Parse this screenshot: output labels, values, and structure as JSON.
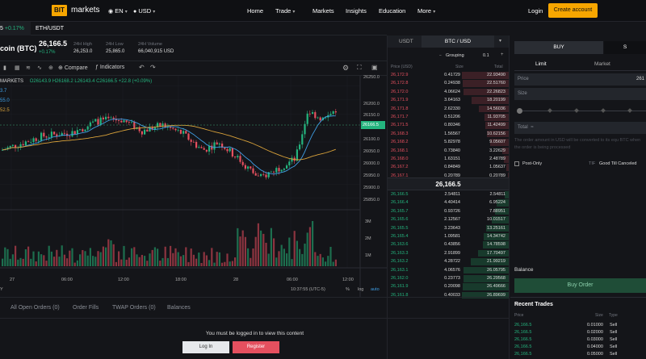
{
  "nav": {
    "logo_box": "BIT",
    "logo_text": "markets",
    "lang": "EN",
    "currency": "USD",
    "links": [
      "Home",
      "Trade",
      "Markets",
      "Insights",
      "Education",
      "More"
    ],
    "login": "Login",
    "create": "Create account"
  },
  "tabs": {
    "t1_price": "5",
    "t1_change": "+0.17%",
    "t2": "ETH/USDT"
  },
  "ticker": {
    "name": "coin (BTC)",
    "price": "26,166.5",
    "change": "+0.17%",
    "high_label": "24H High",
    "high": "26,253.0",
    "low_label": "24H Low",
    "low": "25,865.0",
    "vol_label": "24H Volume",
    "vol": "66,040,915 USD"
  },
  "toolbar": {
    "compare": "Compare",
    "indicators": "Indicators"
  },
  "chart": {
    "legend_sym": "MARKETS",
    "legend_vals": "O26143.9 H26168.2 L26143.4 C26166.5 +22.8 (+0.09%)",
    "ind1": "3.7",
    "ind2": "55.0",
    "ind3": "52.5",
    "yticks": [
      "26250.0",
      "26200.0",
      "26150.0",
      "26100.0",
      "26050.0",
      "26000.0",
      "25950.0",
      "25900.0",
      "25850.0"
    ],
    "price_tag": "26166.5",
    "vol_ticks": [
      "3M",
      "2M",
      "1M"
    ],
    "xticks": [
      "27",
      "06:00",
      "12:00",
      "18:00",
      "28",
      "06:00",
      "12:00"
    ],
    "y_label": "Y",
    "time": "10:37:55 (UTC-5)",
    "pct": "%",
    "log": "log",
    "auto": "auto"
  },
  "chart_data": {
    "type": "candlestick",
    "ylim": [
      25820,
      26280
    ],
    "ticks": [
      26250.0,
      26200.0,
      26150.0,
      26100.0,
      26050.0,
      26000.0,
      25950.0,
      25900.0,
      25850.0
    ],
    "last_price": 26166.5
  },
  "orderbook": {
    "tab1": "USDT",
    "tab2": "BTC / USD",
    "grouping_label": "Grouping",
    "grouping_value": "0.1",
    "h_price": "Price (USD)",
    "h_size": "Size",
    "h_total": "Total",
    "asks": [
      [
        "26,172.9",
        "0.41729",
        "22.93490"
      ],
      [
        "26,172.8",
        "0.24938",
        "22.51760"
      ],
      [
        "26,172.0",
        "4.06624",
        "22.26823"
      ],
      [
        "26,171.9",
        "3.64163",
        "18.20199"
      ],
      [
        "26,171.8",
        "2.62330",
        "14.56036"
      ],
      [
        "26,171.7",
        "0.51206",
        "11.93705"
      ],
      [
        "26,171.5",
        "0.80346",
        "11.42499"
      ],
      [
        "26,168.3",
        "1.56567",
        "10.62156"
      ],
      [
        "26,168.2",
        "5.82978",
        "9.05607"
      ],
      [
        "26,168.1",
        "0.73840",
        "3.22629"
      ],
      [
        "26,168.0",
        "1.63151",
        "2.48789"
      ],
      [
        "26,167.2",
        "0.84849",
        "1.05637"
      ],
      [
        "26,167.1",
        "0.20789",
        "0.20789"
      ]
    ],
    "mid": "26,166.5",
    "bids": [
      [
        "26,166.5",
        "2.54811",
        "2.54811"
      ],
      [
        "26,166.4",
        "4.40414",
        "6.95224"
      ],
      [
        "26,165.7",
        "0.93726",
        "7.88951"
      ],
      [
        "26,165.6",
        "2.12567",
        "10.01517"
      ],
      [
        "26,165.5",
        "3.23643",
        "13.25161"
      ],
      [
        "26,165.4",
        "1.09581",
        "14.34742"
      ],
      [
        "26,163.6",
        "0.43856",
        "14.78598"
      ],
      [
        "26,163.3",
        "2.91899",
        "17.70497"
      ],
      [
        "26,163.2",
        "4.28722",
        "21.99219"
      ],
      [
        "26,163.1",
        "4.06576",
        "26.05795"
      ],
      [
        "26,162.0",
        "0.23773",
        "26.29568"
      ],
      [
        "26,161.9",
        "0.20098",
        "26.49666"
      ],
      [
        "26,161.8",
        "0.40033",
        "26.89699"
      ]
    ]
  },
  "trade": {
    "buy": "BUY",
    "sell": "S",
    "limit": "Limit",
    "market": "Market",
    "price_label": "Price",
    "price_val": "261",
    "size_label": "Size",
    "total_label": "Total",
    "total_sym": "≈",
    "notice": "The order amount in USD will be converted to its equ BTC when the order is being processed",
    "post_only": "Post-Only",
    "tif": "TIF",
    "tif_value": "Good Till Canceled",
    "balance": "Balance",
    "buy_order": "Buy Order",
    "recent_title": "Recent Trades",
    "rt_h_price": "Price",
    "rt_h_size": "Size",
    "rt_h_type": "Type",
    "recent": [
      [
        "26,166.5",
        "0.01000",
        "Sell"
      ],
      [
        "26,166.5",
        "0.02000",
        "Sell"
      ],
      [
        "26,166.5",
        "0.03000",
        "Sell"
      ],
      [
        "26,166.5",
        "0.04000",
        "Sell"
      ],
      [
        "26,166.5",
        "0.05000",
        "Sell"
      ]
    ]
  },
  "bottom": {
    "tabs": [
      "All Open Orders (0)",
      "Order Fills",
      "TWAP Orders (0)",
      "Balances"
    ],
    "msg": "You must be logged in to view this content",
    "login": "Log In",
    "register": "Register"
  },
  "colors": {
    "accent": "#f7a600",
    "up": "#24b47e",
    "down": "#e5505f",
    "register": "#e5505f"
  }
}
